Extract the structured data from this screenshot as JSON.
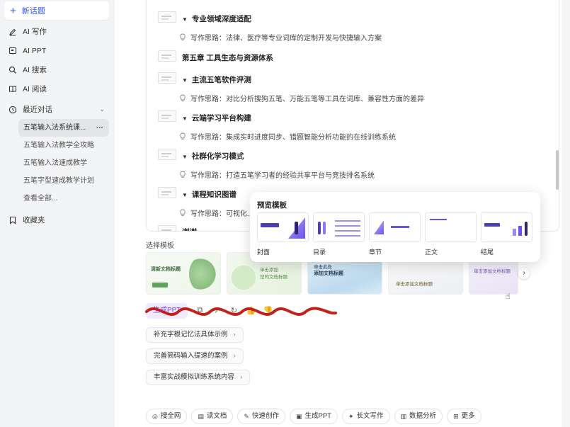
{
  "sidebar": {
    "new_topic": "新话题",
    "nav": [
      {
        "label": "AI 写作",
        "icon": "pen-icon"
      },
      {
        "label": "AI PPT",
        "icon": "ppt-icon"
      },
      {
        "label": "AI 搜索",
        "icon": "search-icon"
      },
      {
        "label": "AI 阅读",
        "icon": "book-icon"
      }
    ],
    "recent_label": "最近对话",
    "recent": [
      "五笔输入法系统课...",
      "五笔输入法教学全攻略",
      "五笔输入法速成教学",
      "五笔字型速成教学计划"
    ],
    "view_all": "查看全部...",
    "favorites": "收藏夹"
  },
  "document": {
    "sections": [
      {
        "title": "专业领域深度适配",
        "idea": "写作思路：法律、医疗等专业词库的定制开发与快捷输入方案"
      },
      {
        "title": "主流五笔软件评测",
        "idea": "写作思路：对比分析搜狗五笔、万能五笔等工具在词库、兼容性方面的差异"
      },
      {
        "title": "云端学习平台构建",
        "idea": "写作思路：集成实时进度同步、错题智能分析功能的在线训练系统"
      },
      {
        "title": "社群化学习模式",
        "idea": "写作思路：打造五笔学习者的经验共享平台与竞技排名系统"
      },
      {
        "title": "课程知识图谱",
        "idea": "写作思路：可视化..."
      }
    ],
    "chapter5": "第五章 工具生态与资源体系",
    "closing": "谢谢"
  },
  "templates": {
    "label": "选择模板",
    "cards": [
      {
        "title": "清新文档标题",
        "sub": ""
      },
      {
        "title": "单击添加",
        "sub": "您的文档标题"
      },
      {
        "title": "单击此处",
        "sub": "添加文档标题"
      },
      {
        "title": "单击添加文档标题",
        "sub": ""
      },
      {
        "title": "单击添加文档标题",
        "sub": ""
      }
    ],
    "next": "›"
  },
  "actions": {
    "generate": "生成PPT"
  },
  "suggestions": [
    "补充字根记忆法具体示例",
    "完善简码输入提速的案例",
    "丰富实战模拟训练系统内容"
  ],
  "toolbar": [
    {
      "label": "搜全网",
      "icon": "globe-icon"
    },
    {
      "label": "读文档",
      "icon": "doc-icon"
    },
    {
      "label": "快速创作",
      "icon": "pen-icon"
    },
    {
      "label": "生成PPT",
      "icon": "ppt-icon"
    },
    {
      "label": "长文写作",
      "icon": "longtext-icon"
    },
    {
      "label": "数据分析",
      "icon": "chart-icon"
    },
    {
      "label": "更多",
      "icon": "grid-icon"
    }
  ],
  "preview": {
    "title": "预览模板",
    "pages": [
      "封面",
      "目录",
      "章节",
      "正文",
      "结尾"
    ]
  },
  "colors": {
    "accent": "#2f54eb",
    "purple": "#7b4dff",
    "scribble": "#c0221a"
  }
}
